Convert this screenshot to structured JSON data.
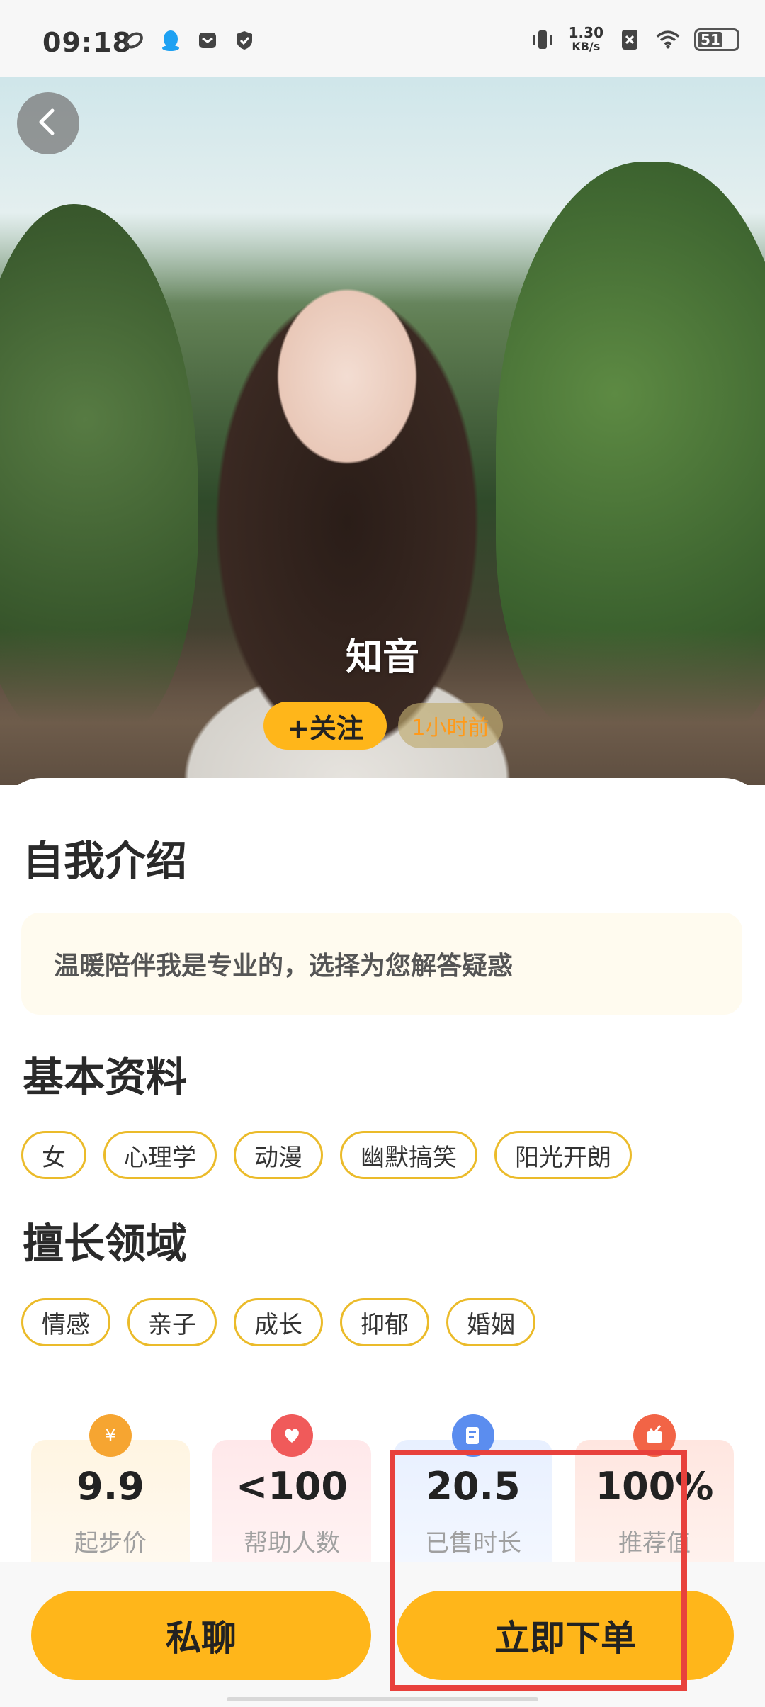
{
  "status_bar": {
    "time": "09:18",
    "net_speed_value": "1.30",
    "net_speed_unit": "KB/s",
    "battery_level": "51"
  },
  "profile": {
    "nickname": "知音",
    "follow_label": "+关注",
    "last_active": "1小时前"
  },
  "sections": {
    "intro_title": "自我介绍",
    "intro_text": "温暖陪伴我是专业的，选择为您解答疑惑",
    "basic_title": "基本资料",
    "basic_tags": [
      "女",
      "心理学",
      "动漫",
      "幽默搞笑",
      "阳光开朗"
    ],
    "skills_title": "擅长领域",
    "skills_tags": [
      "情感",
      "亲子",
      "成长",
      "抑郁",
      "婚姻"
    ]
  },
  "stats": [
    {
      "value": "9.9",
      "label": "起步价",
      "icon": "money-bag-icon",
      "color": "#f6a531"
    },
    {
      "value": "<100",
      "label": "帮助人数",
      "icon": "heart-hand-icon",
      "color": "#f05a5a"
    },
    {
      "value": "20.5",
      "label": "已售时长",
      "icon": "document-edit-icon",
      "color": "#5b8def"
    },
    {
      "value": "100%",
      "label": "推荐值",
      "icon": "thumb-card-icon",
      "color": "#f26446"
    }
  ],
  "actions": {
    "chat_label": "私聊",
    "order_label": "立即下单"
  },
  "colors": {
    "accent": "#ffb61a",
    "tag_border": "#ebbb2a",
    "highlight": "#e8413c"
  }
}
